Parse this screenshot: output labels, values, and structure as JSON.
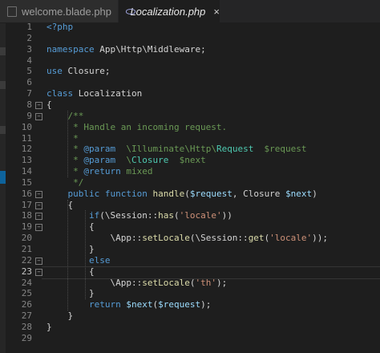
{
  "tabs": [
    {
      "label": "welcome.blade.php",
      "icon": "file-icon",
      "active": false
    },
    {
      "label": "Localization.php",
      "icon": "php-file-icon",
      "active": true,
      "close": "×"
    }
  ],
  "line_numbers": [
    "1",
    "2",
    "3",
    "4",
    "5",
    "6",
    "7",
    "8",
    "9",
    "10",
    "11",
    "12",
    "13",
    "14",
    "15",
    "16",
    "17",
    "18",
    "19",
    "20",
    "21",
    "22",
    "23",
    "24",
    "25",
    "26",
    "27",
    "28",
    "29"
  ],
  "current_line": "23",
  "fold_markers": [
    "8",
    "9",
    "16",
    "17",
    "18",
    "19",
    "22",
    "23"
  ],
  "code": [
    [
      {
        "t": "<?php",
        "c": "kw"
      }
    ],
    [],
    [
      {
        "t": "namespace ",
        "c": "kw"
      },
      {
        "t": "App\\Http\\Middleware;",
        "c": "plain"
      }
    ],
    [],
    [
      {
        "t": "use ",
        "c": "kw"
      },
      {
        "t": "Closure;",
        "c": "plain"
      }
    ],
    [],
    [
      {
        "t": "class ",
        "c": "kw"
      },
      {
        "t": "Localization",
        "c": "plain"
      }
    ],
    [
      {
        "t": "{",
        "c": "plain"
      }
    ],
    [
      {
        "t": "    /**",
        "c": "cm"
      }
    ],
    [
      {
        "t": "     * Handle an incoming request.",
        "c": "cm"
      }
    ],
    [
      {
        "t": "     *",
        "c": "cm"
      }
    ],
    [
      {
        "t": "     * ",
        "c": "cm"
      },
      {
        "t": "@param",
        "c": "cmk"
      },
      {
        "t": "  \\Illuminate\\Http\\",
        "c": "cm"
      },
      {
        "t": "Request",
        "c": "cmt"
      },
      {
        "t": "  $request",
        "c": "cm"
      }
    ],
    [
      {
        "t": "     * ",
        "c": "cm"
      },
      {
        "t": "@param",
        "c": "cmk"
      },
      {
        "t": "  \\",
        "c": "cm"
      },
      {
        "t": "Closure",
        "c": "cmt"
      },
      {
        "t": "  $next",
        "c": "cm"
      }
    ],
    [
      {
        "t": "     * ",
        "c": "cm"
      },
      {
        "t": "@return",
        "c": "cmk"
      },
      {
        "t": " mixed",
        "c": "cm"
      }
    ],
    [
      {
        "t": "     */",
        "c": "cm"
      }
    ],
    [
      {
        "t": "    public ",
        "c": "kw"
      },
      {
        "t": "function ",
        "c": "kw"
      },
      {
        "t": "handle",
        "c": "fn"
      },
      {
        "t": "(",
        "c": "plain"
      },
      {
        "t": "$request",
        "c": "var"
      },
      {
        "t": ", Closure ",
        "c": "plain"
      },
      {
        "t": "$next",
        "c": "var"
      },
      {
        "t": ")",
        "c": "plain"
      }
    ],
    [
      {
        "t": "    {",
        "c": "plain"
      }
    ],
    [
      {
        "t": "        if",
        "c": "kw"
      },
      {
        "t": "(\\Session::",
        "c": "plain"
      },
      {
        "t": "has",
        "c": "fn"
      },
      {
        "t": "(",
        "c": "plain"
      },
      {
        "t": "'locale'",
        "c": "str"
      },
      {
        "t": "))",
        "c": "plain"
      }
    ],
    [
      {
        "t": "        {",
        "c": "plain"
      }
    ],
    [
      {
        "t": "            \\App::",
        "c": "plain"
      },
      {
        "t": "setLocale",
        "c": "fn"
      },
      {
        "t": "(\\Session::",
        "c": "plain"
      },
      {
        "t": "get",
        "c": "fn"
      },
      {
        "t": "(",
        "c": "plain"
      },
      {
        "t": "'locale'",
        "c": "str"
      },
      {
        "t": "));",
        "c": "plain"
      }
    ],
    [
      {
        "t": "        }",
        "c": "plain"
      }
    ],
    [
      {
        "t": "        else",
        "c": "kw"
      }
    ],
    [
      {
        "t": "        {",
        "c": "plain"
      }
    ],
    [
      {
        "t": "            \\App::",
        "c": "plain"
      },
      {
        "t": "setLocale",
        "c": "fn"
      },
      {
        "t": "(",
        "c": "plain"
      },
      {
        "t": "'th'",
        "c": "str"
      },
      {
        "t": ");",
        "c": "plain"
      }
    ],
    [
      {
        "t": "        }",
        "c": "plain"
      }
    ],
    [
      {
        "t": "        return ",
        "c": "kw"
      },
      {
        "t": "$next",
        "c": "var"
      },
      {
        "t": "(",
        "c": "plain"
      },
      {
        "t": "$request",
        "c": "var"
      },
      {
        "t": ");",
        "c": "plain"
      }
    ],
    [
      {
        "t": "    }",
        "c": "plain"
      }
    ],
    [
      {
        "t": "}",
        "c": "plain"
      }
    ],
    []
  ],
  "colors": {
    "background": "#1e1e1e",
    "keyword": "#569cd6",
    "comment": "#6a9955",
    "function": "#dcdcaa",
    "string": "#ce9178",
    "variable": "#9cdcfe"
  }
}
